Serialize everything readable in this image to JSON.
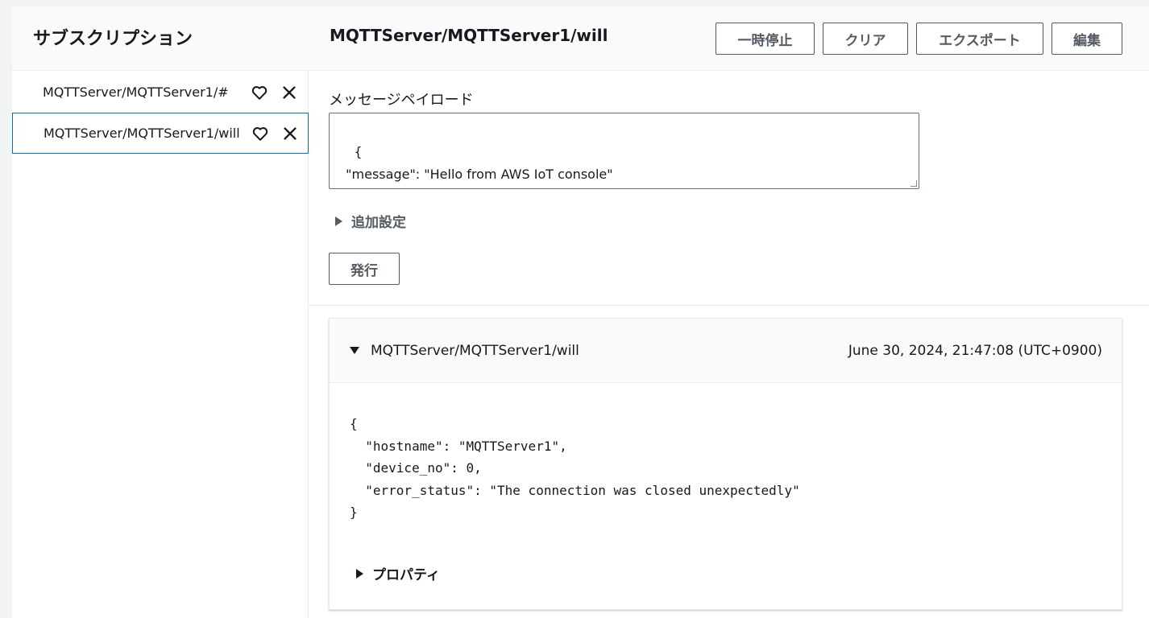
{
  "sidebar": {
    "title": "サブスクリプション",
    "items": [
      {
        "label": "MQTTServer/MQTTServer1/#",
        "selected": false
      },
      {
        "label": "MQTTServer/MQTTServer1/will",
        "selected": true
      }
    ]
  },
  "header": {
    "topic": "MQTTServer/MQTTServer1/will",
    "buttons": {
      "pause": "一時停止",
      "clear": "クリア",
      "export": "エクスポート",
      "edit": "編集"
    }
  },
  "publish": {
    "payload_label": "メッセージペイロード",
    "payload_value": "{\n  \"message\": \"Hello from AWS IoT console\"\n}",
    "additional_settings": "追加設定",
    "publish_button": "発行"
  },
  "message": {
    "topic": "MQTTServer/MQTTServer1/will",
    "timestamp": "June 30, 2024, 21:47:08 (UTC+0900)",
    "body": "{\n  \"hostname\": \"MQTTServer1\",\n  \"device_no\": 0,\n  \"error_status\": \"The connection was closed unexpectedly\"\n}",
    "properties_label": "プロパティ"
  },
  "colors": {
    "accent": "#0073bb",
    "button_text": "#545b64",
    "background": "#f2f3f3"
  }
}
